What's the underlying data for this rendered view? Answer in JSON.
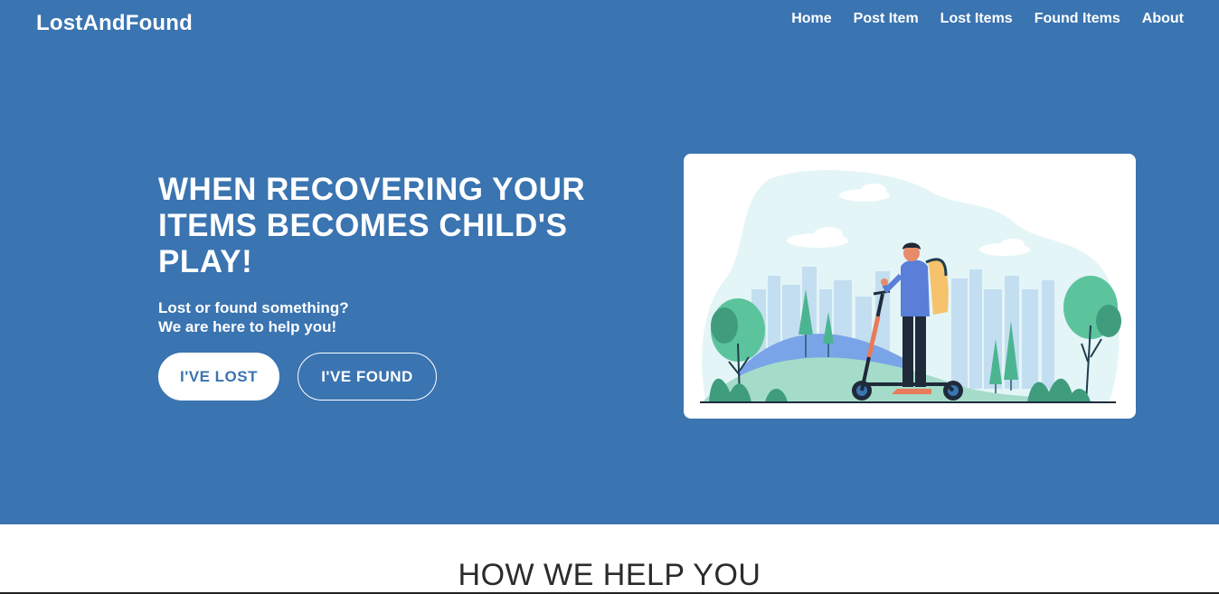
{
  "brand": "LostAndFound",
  "nav": {
    "items": [
      "Home",
      "Post Item",
      "Lost Items",
      "Found Items",
      "About"
    ]
  },
  "hero": {
    "headline": "WHEN RECOVERING YOUR ITEMS BECOMES CHILD'S PLAY!",
    "subline_1": "Lost or found something?",
    "subline_2": "We are here to help you!",
    "lost_button": "I'VE LOST",
    "found_button": "I'VE FOUND"
  },
  "section": {
    "title": "HOW WE HELP YOU"
  },
  "colors": {
    "hero_bg": "#3a74b1",
    "white": "#ffffff",
    "title_text": "#2b2b2b"
  },
  "icons": [
    "scooter-rider-illustration"
  ]
}
